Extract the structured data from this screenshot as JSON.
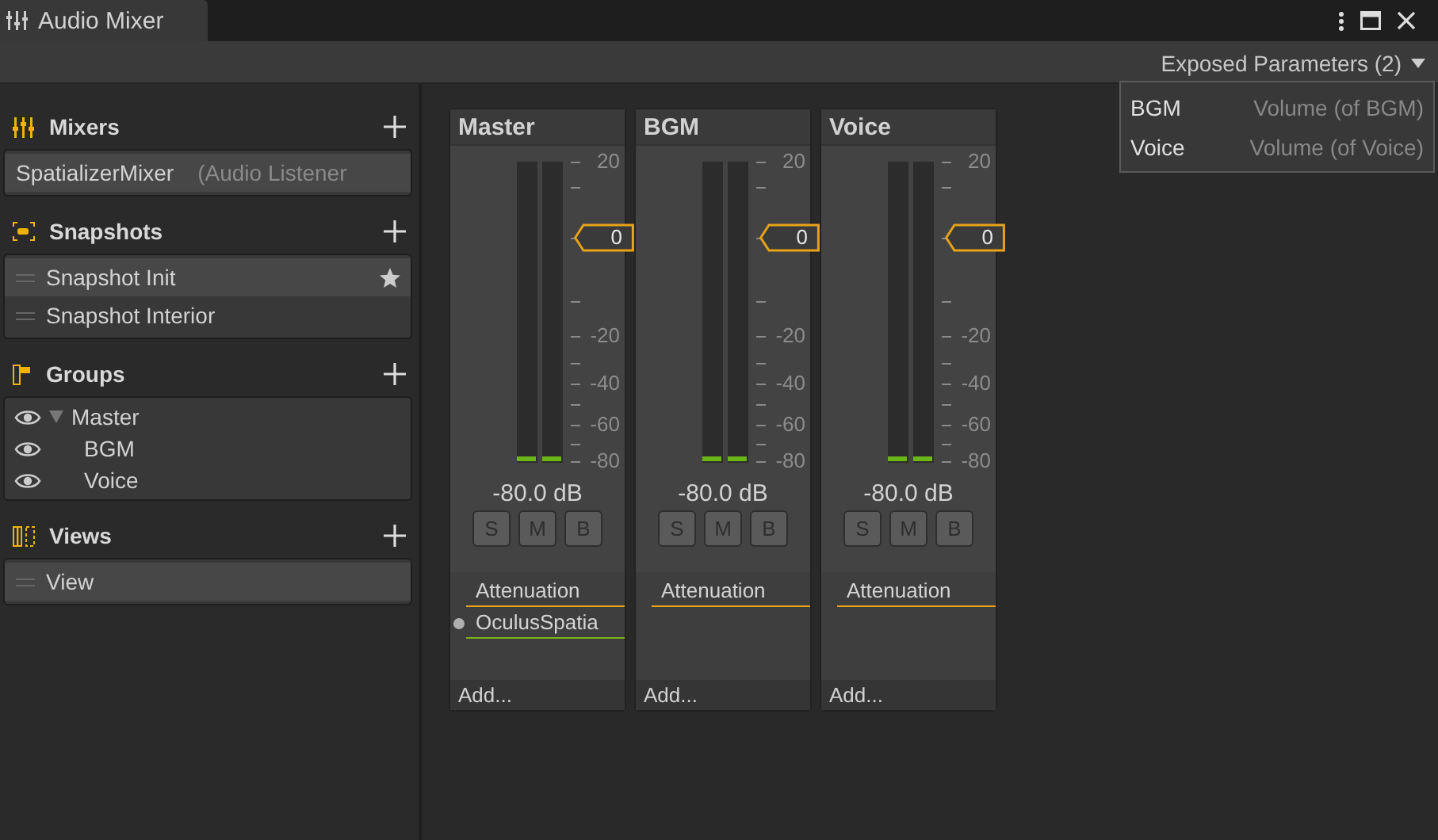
{
  "window": {
    "tab_title": "Audio Mixer"
  },
  "toolbar": {
    "exposed_parameters": {
      "label": "Exposed Parameters (2)",
      "expanded": true,
      "items": [
        {
          "name": "BGM",
          "description": "Volume (of BGM)"
        },
        {
          "name": "Voice",
          "description": "Volume (of Voice)"
        }
      ]
    }
  },
  "sidebar": {
    "sections": [
      {
        "kind": "mixers",
        "title": "Mixers",
        "items": [
          {
            "name": "SpatializerMixer",
            "note": "(Audio Listener",
            "selected": true
          }
        ]
      },
      {
        "kind": "snapshots",
        "title": "Snapshots",
        "items": [
          {
            "name": "Snapshot Init",
            "selected": true,
            "starred": true
          },
          {
            "name": "Snapshot Interior",
            "selected": false,
            "starred": false
          }
        ]
      },
      {
        "kind": "groups",
        "title": "Groups",
        "items": [
          {
            "name": "Master",
            "visible": true,
            "expanded": true,
            "children": [
              {
                "name": "BGM",
                "visible": true
              },
              {
                "name": "Voice",
                "visible": true
              }
            ]
          }
        ]
      },
      {
        "kind": "views",
        "title": "Views",
        "items": [
          {
            "name": "View",
            "selected": true
          }
        ]
      }
    ]
  },
  "strips": [
    {
      "name": "Master",
      "scale": [
        "20",
        "-20",
        "-40",
        "-60",
        "-80"
      ],
      "fader": "0",
      "reading": "-80.0 dB",
      "buttons": [
        {
          "label": "S",
          "selected": false
        },
        {
          "label": "M",
          "selected": false
        },
        {
          "label": "B",
          "selected": false
        }
      ],
      "effects": [
        {
          "name": "Attenuation",
          "color": "#e8a317",
          "dot": false
        },
        {
          "name": "OculusSpatia",
          "color": "#7cb518",
          "dot": true
        }
      ],
      "add": "Add..."
    },
    {
      "name": "BGM",
      "scale": [
        "20",
        "-20",
        "-40",
        "-60",
        "-80"
      ],
      "fader": "0",
      "reading": "-80.0 dB",
      "buttons": [
        {
          "label": "S",
          "selected": false
        },
        {
          "label": "M",
          "selected": false
        },
        {
          "label": "B",
          "selected": false
        }
      ],
      "effects": [
        {
          "name": "Attenuation",
          "color": "#e8a317",
          "dot": false
        }
      ],
      "add": "Add..."
    },
    {
      "name": "Voice",
      "scale": [
        "20",
        "-20",
        "-40",
        "-60",
        "-80"
      ],
      "fader": "0",
      "reading": "-80.0 dB",
      "buttons": [
        {
          "label": "S",
          "selected": false
        },
        {
          "label": "M",
          "selected": false
        },
        {
          "label": "B",
          "selected": false
        }
      ],
      "effects": [
        {
          "name": "Attenuation",
          "color": "#e8a317",
          "dot": false
        }
      ],
      "add": "Add..."
    }
  ]
}
